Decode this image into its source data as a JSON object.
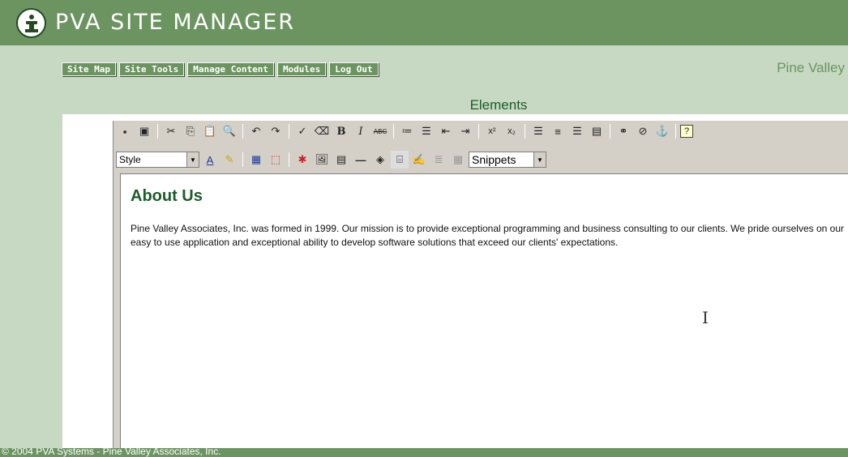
{
  "header": {
    "title": "PVA SITE MANAGER"
  },
  "nav": [
    "Site Map",
    "Site Tools",
    "Manage Content",
    "Modules",
    "Log Out"
  ],
  "company": "Pine Valley",
  "section_title": "Elements",
  "toolbar2": {
    "style_label": "Style",
    "snippets_label": "Snippets"
  },
  "content": {
    "heading": "About Us",
    "body": "Pine Valley Associates, Inc. was formed in 1999. Our mission is to provide exceptional programming and business consulting to our clients. We pride ourselves on our easy to use application and exceptional ability to develop software solutions that exceed our clients' expectations."
  },
  "footer": "© 2004 PVA Systems - Pine Valley Associates, Inc.",
  "colors": {
    "header": "#6c9461",
    "background": "#c7d9c2",
    "accent": "#1d5c2b"
  }
}
